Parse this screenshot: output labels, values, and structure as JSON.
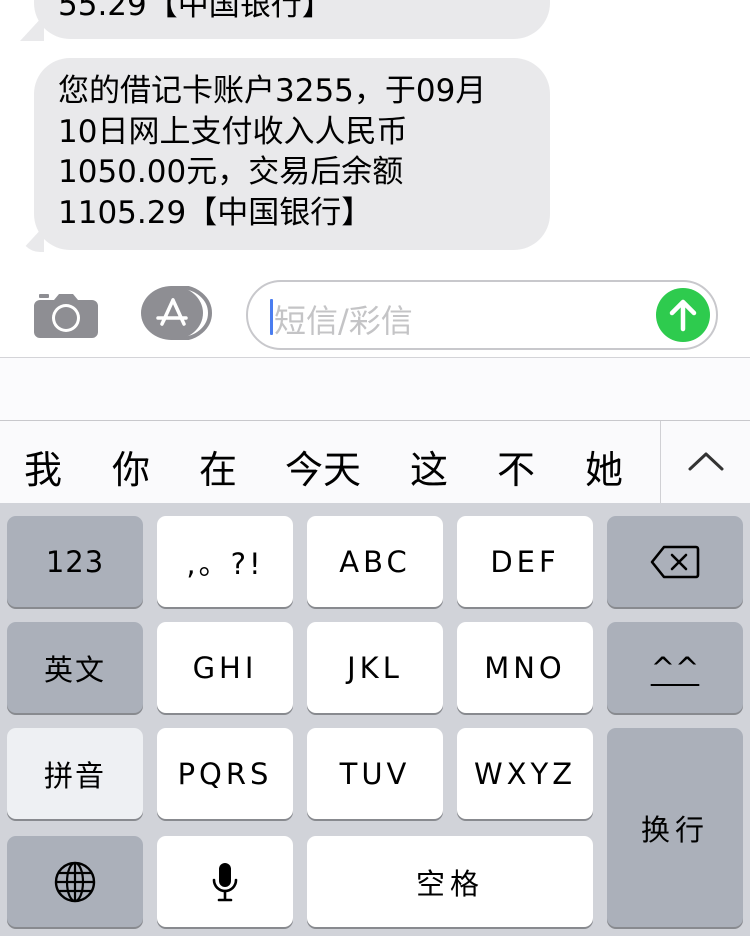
{
  "messages": {
    "previous_partial": "55.29【中国银行】",
    "latest_lines": [
      "您的借记卡账户3255，于09月",
      "10日网上支付收入人民币",
      "1050.00元，交易后余额",
      "1105.29【中国银行】"
    ]
  },
  "input_bar": {
    "camera_icon": "camera-icon",
    "apps_icon": "app-store-icon",
    "placeholder": "短信/彩信",
    "send_icon": "arrow-up-icon",
    "send_color": "#2ecb4e",
    "caret_color": "#4a7df0"
  },
  "candidates": [
    "我",
    "你",
    "在",
    "今天",
    "这",
    "不",
    "她"
  ],
  "candidate_expand_icon": "chevron-up-icon",
  "keyboard": {
    "row1": [
      "123",
      ",。?!",
      "ABC",
      "DEF"
    ],
    "row1_delete_icon": "delete-backspace-icon",
    "row2": [
      "英文",
      "GHI",
      "JKL",
      "MNO",
      "^^"
    ],
    "row3": [
      "拼音",
      "PQRS",
      "TUV",
      "WXYZ"
    ],
    "return_label": "换行",
    "globe_icon": "globe-icon",
    "mic_icon": "microphone-icon",
    "space_label": "空格"
  }
}
